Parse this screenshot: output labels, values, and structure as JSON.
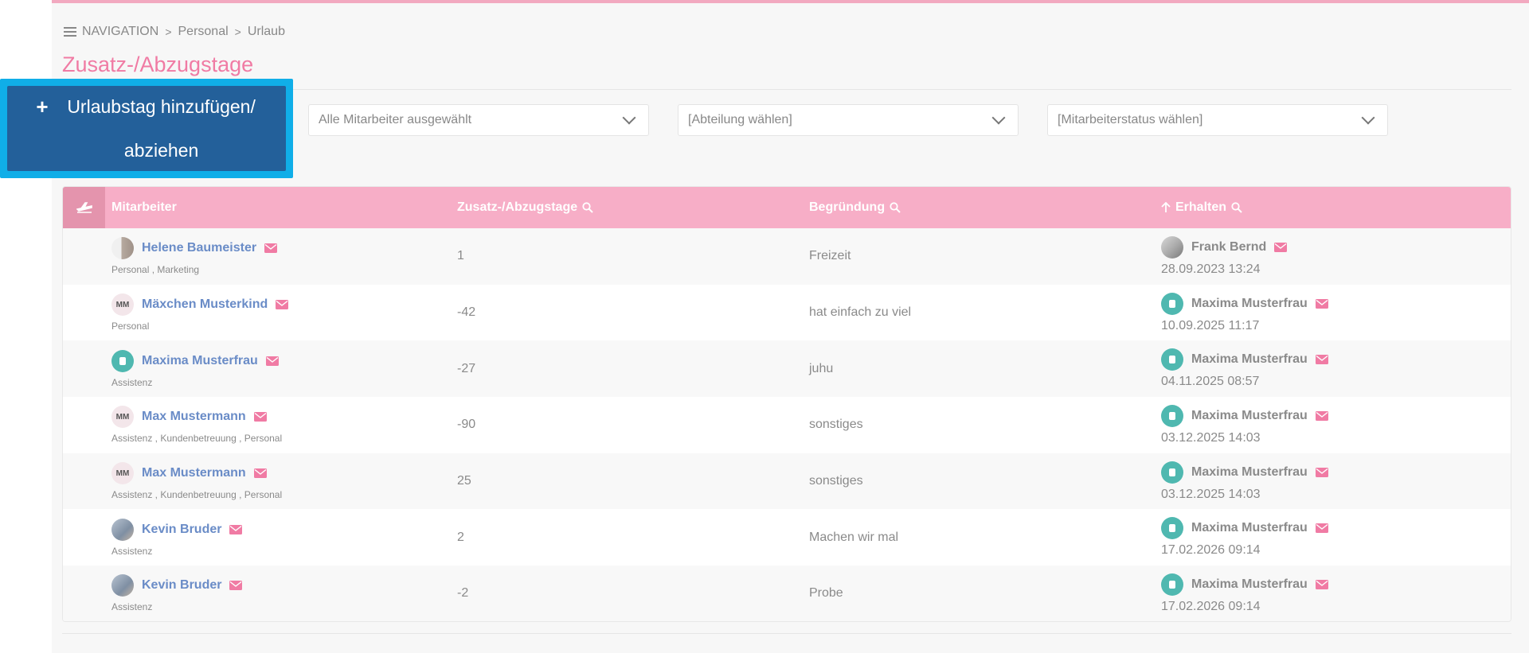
{
  "breadcrumb": {
    "root": "NAVIGATION",
    "level1": "Personal",
    "level2": "Urlaub"
  },
  "page_title": "Zusatz-/Abzugstage",
  "add_button": {
    "icon": "plus-icon",
    "label": "Urlaubstag hinzufügen/ abziehen"
  },
  "filters": {
    "employees": "Alle Mitarbeiter ausgewählt",
    "department": "[Abteilung wählen]",
    "status": "[Mitarbeiterstatus wählen]"
  },
  "table": {
    "headers": {
      "employee": "Mitarbeiter",
      "days": "Zusatz-/Abzugstage",
      "reason": "Begründung",
      "received": "Erhalten"
    },
    "rows": [
      {
        "name": "Helene Baumeister",
        "dept": "Personal , Marketing",
        "days": "1",
        "reason": "Freizeit",
        "by": "Frank Bernd",
        "date": "28.09.2023 13:24"
      },
      {
        "name": "Mäxchen Musterkind",
        "initials": "MM",
        "dept": "Personal",
        "days": "-42",
        "reason": "hat einfach zu viel",
        "by": "Maxima Musterfrau",
        "date": "10.09.2025 11:17"
      },
      {
        "name": "Maxima Musterfrau",
        "dept": "Assistenz",
        "days": "-27",
        "reason": "juhu",
        "by": "Maxima Musterfrau",
        "date": "04.11.2025 08:57"
      },
      {
        "name": "Max Mustermann",
        "initials": "MM",
        "dept": "Assistenz , Kundenbetreuung , Personal",
        "days": "-90",
        "reason": "sonstiges",
        "by": "Maxima Musterfrau",
        "date": "03.12.2025 14:03"
      },
      {
        "name": "Max Mustermann",
        "initials": "MM",
        "dept": "Assistenz , Kundenbetreuung , Personal",
        "days": "25",
        "reason": "sonstiges",
        "by": "Maxima Musterfrau",
        "date": "03.12.2025 14:03"
      },
      {
        "name": "Kevin Bruder",
        "dept": "Assistenz",
        "days": "2",
        "reason": "Machen wir mal",
        "by": "Maxima Musterfrau",
        "date": "17.02.2026 09:14"
      },
      {
        "name": "Kevin Bruder",
        "dept": "Assistenz",
        "days": "-2",
        "reason": "Probe",
        "by": "Maxima Musterfrau",
        "date": "17.02.2026 09:14"
      }
    ]
  },
  "colors": {
    "accent": "#f07ba4",
    "header_bg": "#f7aec7",
    "button_bg": "#23609a",
    "highlight": "#10aee8",
    "link": "#6a8cc7"
  }
}
